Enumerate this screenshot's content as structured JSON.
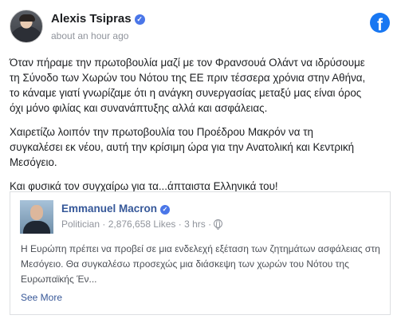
{
  "post": {
    "author": "Alexis Tsipras",
    "time": "about an hour ago",
    "paragraphs": [
      "Όταν πήραμε την πρωτοβουλία μαζί με τον Φρανσουά Ολάντ να ιδρύσουμε\nτη Σύνοδο των Χωρών του Νότου της ΕΕ πριν τέσσερα χρόνια στην Αθήνα,\nτο κάναμε γιατί γνωρίζαμε ότι η ανάγκη συνεργασίας μεταξύ μας είναι όρος\nόχι μόνο φιλίας και συνανάπτυξης αλλά και ασφάλειας.",
      "Χαιρετίζω λοιπόν την πρωτοβουλία του Προέδρου Μακρόν να τη\nσυγκαλέσει εκ νέου, αυτή την κρίσιμη ώρα για την Ανατολική και Κεντρική\nΜεσόγειο.",
      "Και φυσικά τον συγχαίρω για τα...άπταιστα Ελληνικά του!"
    ]
  },
  "shared": {
    "name": "Emmanuel Macron",
    "meta": "Politician · 2,876,658 Likes · 3 hrs ·",
    "text": "Η Ευρώπη πρέπει να προβεί σε μια ενδελεχή εξέταση των ζητημάτων ασφάλειας στη\nΜεσόγειο. Θα συγκαλέσω προσεχώς μια διάσκεψη των χωρών του Νότου της\nΕυρωπαϊκής Έν...",
    "see_more": "See More"
  },
  "icons": {
    "facebook": "facebook-logo-icon",
    "verified": "verified-badge-icon",
    "globe": "globe-icon"
  },
  "colors": {
    "brand": "#1877f2",
    "link": "#365899",
    "muted": "#90949c"
  }
}
